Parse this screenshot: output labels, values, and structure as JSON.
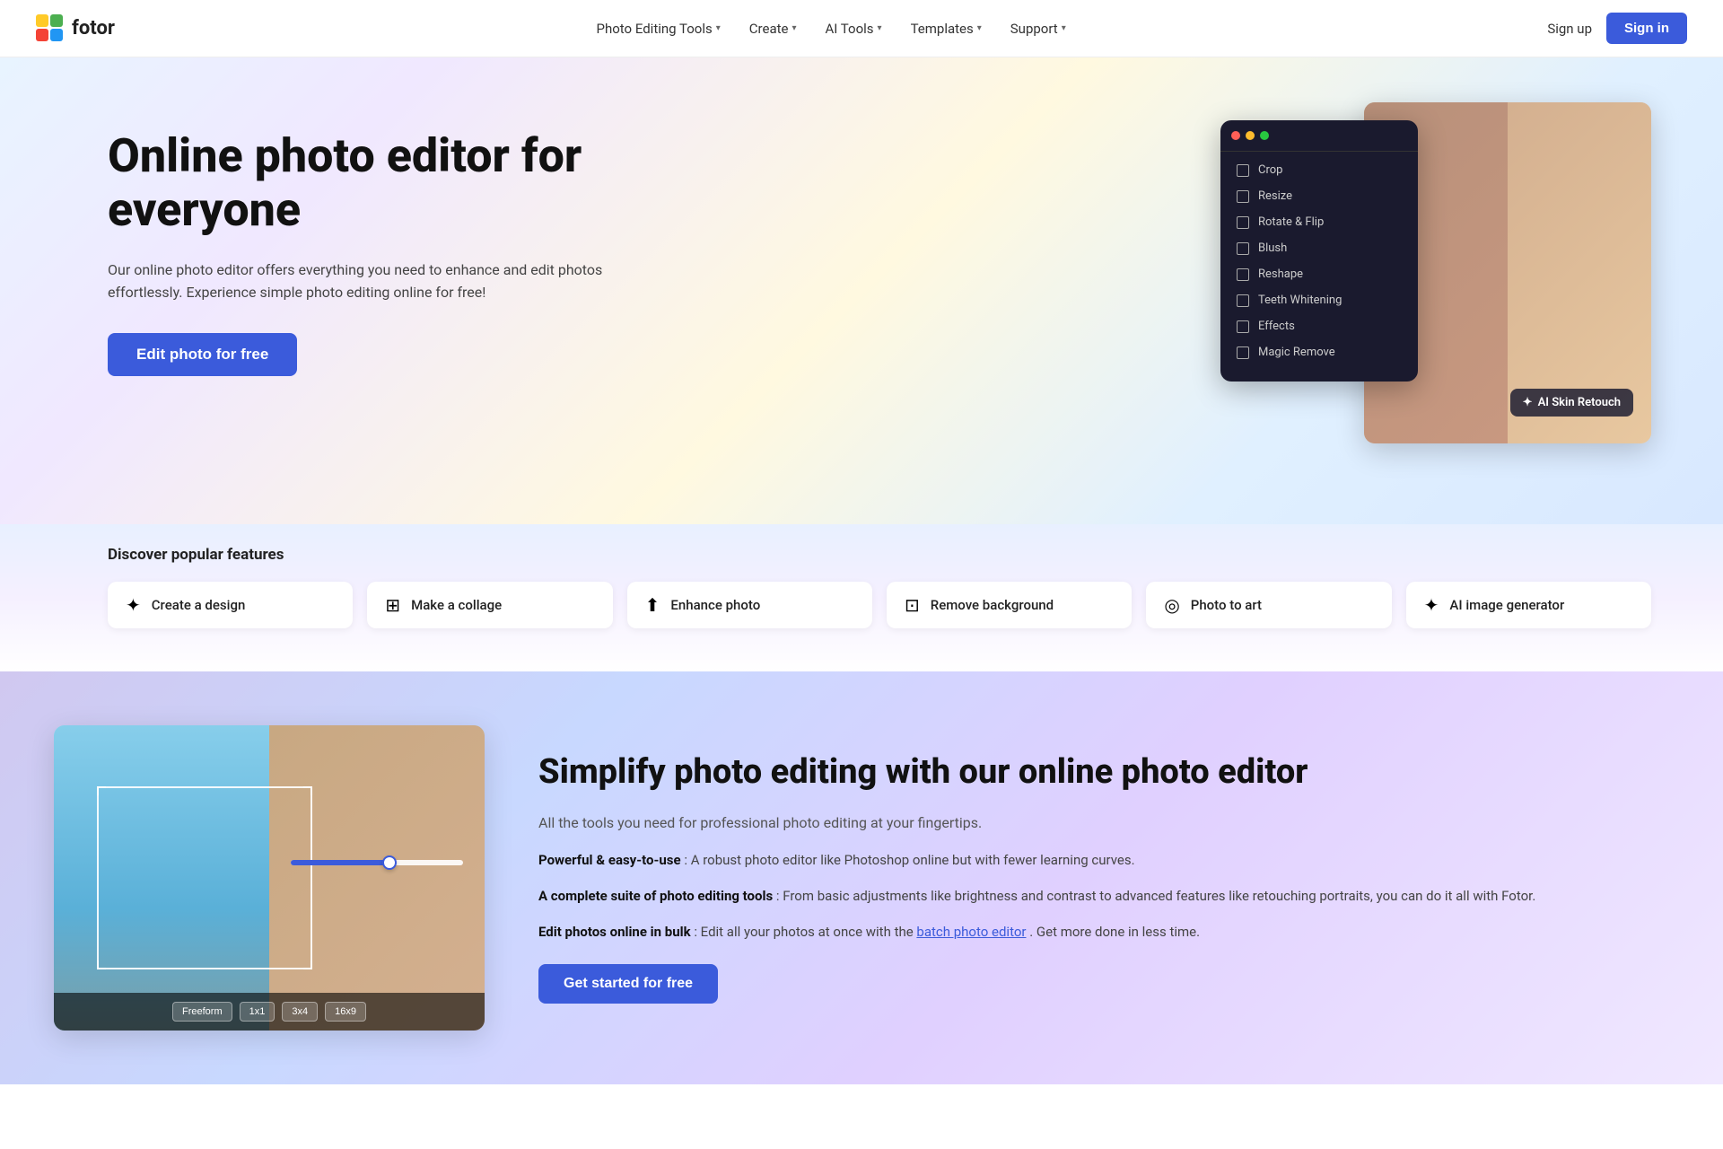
{
  "brand": {
    "name": "fotor",
    "logo_emoji": "🟡🟢🔵🔴"
  },
  "nav": {
    "links": [
      {
        "label": "Photo Editing Tools",
        "has_chevron": true
      },
      {
        "label": "Create",
        "has_chevron": true
      },
      {
        "label": "AI Tools",
        "has_chevron": true
      },
      {
        "label": "Templates",
        "has_chevron": true
      },
      {
        "label": "Support",
        "has_chevron": true
      }
    ],
    "sign_up": "Sign up",
    "sign_in": "Sign in"
  },
  "hero": {
    "title": "Online photo editor for everyone",
    "subtitle": "Our online photo editor offers everything you need to enhance and edit photos effortlessly. Experience simple photo editing online for free!",
    "cta_button": "Edit photo for free",
    "editor_tools": [
      {
        "icon": "⊡",
        "label": "Crop"
      },
      {
        "icon": "⤢",
        "label": "Resize"
      },
      {
        "icon": "↻",
        "label": "Rotate & Flip"
      },
      {
        "icon": "◐",
        "label": "Blush"
      },
      {
        "icon": "⬡",
        "label": "Reshape"
      },
      {
        "icon": "✦",
        "label": "Teeth Whitening"
      },
      {
        "icon": "✧",
        "label": "Effects"
      },
      {
        "icon": "✕",
        "label": "Magic Remove"
      }
    ],
    "ai_badge": "AI Skin Retouch"
  },
  "features": {
    "section_title": "Discover popular features",
    "items": [
      {
        "icon": "✦",
        "label": "Create a design"
      },
      {
        "icon": "⊞",
        "label": "Make a collage"
      },
      {
        "icon": "⬆",
        "label": "Enhance photo"
      },
      {
        "icon": "⊡",
        "label": "Remove background"
      },
      {
        "icon": "◎",
        "label": "Photo to art"
      },
      {
        "icon": "✦",
        "label": "AI image generator"
      }
    ]
  },
  "section2": {
    "title": "Simplify photo editing with our online photo editor",
    "subtitle": "All the tools you need for professional photo editing at your fingertips.",
    "points": [
      {
        "bold": "Powerful & easy-to-use",
        "text": ": A robust photo editor like Photoshop online but with fewer learning curves."
      },
      {
        "bold": "A complete suite of photo editing tools",
        "text": ": From basic adjustments like brightness and contrast to advanced features like retouching portraits, you can do it all with Fotor."
      },
      {
        "bold": "Edit photos online in bulk",
        "text": ": Edit all your photos at once with the ",
        "link": "batch photo editor",
        "text_after": ". Get more done in less time."
      }
    ],
    "demo_toolbar_items": [
      "Freeform",
      "1x1",
      "3x4",
      "16x9"
    ],
    "get_started": "Get started for free"
  }
}
